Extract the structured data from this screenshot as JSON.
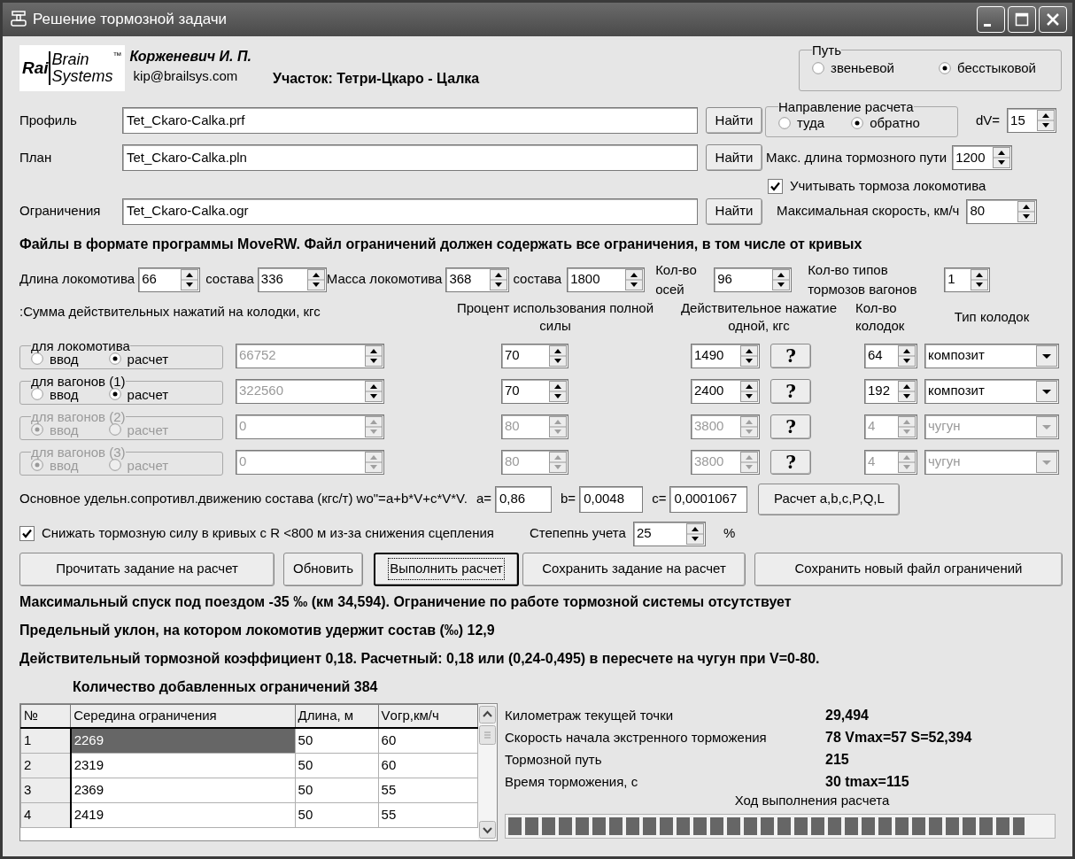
{
  "window": {
    "title": "Решение тормозной задачи"
  },
  "logo": {
    "word_1": "Rai",
    "word_2": "Brain",
    "word_3": "Systems",
    "trademark": "™"
  },
  "author": {
    "name": "Корженевич И. П.",
    "email": "kip@brailsys.com"
  },
  "section": "Участок: Тетри-Цкаро - Цалка",
  "track_type": {
    "legend": "Путь",
    "options": [
      {
        "label": "звеньевой",
        "selected": false
      },
      {
        "label": "бесстыковой",
        "selected": true
      }
    ]
  },
  "files": [
    {
      "label": "Профиль",
      "value": "Tet_Ckaro-Calka.prf",
      "button": "Найти"
    },
    {
      "label": "План",
      "value": "Tet_Ckaro-Calka.pln",
      "button": "Найти"
    },
    {
      "label": "Ограничения",
      "value": "Tet_Ckaro-Calka.ogr",
      "button": "Найти"
    }
  ],
  "direction": {
    "legend": "Направление расчета",
    "options": [
      {
        "label": "туда",
        "selected": false
      },
      {
        "label": "обратно",
        "selected": true
      }
    ]
  },
  "dv": {
    "label": "dV=",
    "value": "15"
  },
  "max_brake_distance": {
    "label": "Макс. длина тормозного пути",
    "value": "1200"
  },
  "loco_brakes": {
    "label": "Учитывать тормоза локомотива",
    "checked": true
  },
  "max_speed": {
    "label": "Максимальная скорость, км/ч",
    "value": "80"
  },
  "files_note": "Файлы в формате программы MoveRW. Файл ограничений должен содержать все ограничения, в том числе от кривых",
  "train_params": [
    {
      "label": "Длина локомотива",
      "value": "66"
    },
    {
      "label": "состава",
      "value": "336"
    },
    {
      "label": "Масса локомотива",
      "value": "368"
    },
    {
      "label": "состава",
      "value": "1800"
    },
    {
      "label": "Кол-во осей",
      "value": "96"
    },
    {
      "label": "Кол-во типов тормозов вагонов",
      "value": "1"
    }
  ],
  "brake_headers": [
    ":Сумма действительных нажатий на колодки, кгс",
    "Процент использования полной силы",
    "Действительное нажатие одной, кгс",
    "Кол-во колодок",
    "Тип колодок"
  ],
  "brake_rows": [
    {
      "legend": "для локомотива",
      "disabled": false,
      "options": [
        {
          "label": "ввод",
          "selected": false
        },
        {
          "label": "расчет",
          "selected": true
        }
      ],
      "total": "66752",
      "percent": "70",
      "actual": "1490",
      "help": "?",
      "count": "64",
      "shoe_type": "композит"
    },
    {
      "legend": "для вагонов (1)",
      "disabled": false,
      "options": [
        {
          "label": "ввод",
          "selected": false
        },
        {
          "label": "расчет",
          "selected": true
        }
      ],
      "total": "322560",
      "percent": "70",
      "actual": "2400",
      "help": "?",
      "count": "192",
      "shoe_type": "композит"
    },
    {
      "legend": "для вагонов (2)",
      "disabled": true,
      "options": [
        {
          "label": "ввод",
          "selected": true
        },
        {
          "label": "расчет",
          "selected": false
        }
      ],
      "total": "0",
      "percent": "80",
      "actual": "3800",
      "help": "?",
      "count": "4",
      "shoe_type": "чугун"
    },
    {
      "legend": "для вагонов (3)",
      "disabled": true,
      "options": [
        {
          "label": "ввод",
          "selected": true
        },
        {
          "label": "расчет",
          "selected": false
        }
      ],
      "total": "0",
      "percent": "80",
      "actual": "3800",
      "help": "?",
      "count": "4",
      "shoe_type": "чугун"
    }
  ],
  "resistance": {
    "label": "Основное удельн.сопротивл.движению состава (кгс/т) wo\"=a+b*V+c*V*V.",
    "coefficients": [
      {
        "label": "a=",
        "value": "0,86"
      },
      {
        "label": "b=",
        "value": "0,0048"
      },
      {
        "label": "c=",
        "value": "0,0001067"
      }
    ],
    "button": "Расчет a,b,c,P,Q,L"
  },
  "curve_reduction": {
    "label": "Снижать тормозную силу в кривых с R <800 м из-за снижения сцепления",
    "checked": true,
    "degree_label": "Степепнь учета",
    "degree_value": "25",
    "unit": "%"
  },
  "actions": [
    {
      "label": "Прочитать задание на расчет",
      "focused": false
    },
    {
      "label": "Обновить",
      "focused": false
    },
    {
      "label": "Выполнить расчет",
      "focused": true
    },
    {
      "label": "Сохранить задание на расчет",
      "focused": false
    },
    {
      "label": "Сохранить новый файл ограничений",
      "focused": false
    }
  ],
  "results": [
    "Максимальный спуск под поездом -35 ‰ (км 34,594). Ограничение по работе тормозной системы отсутствует",
    "Предельный уклон, на котором локомотив удержит состав (‰) 12,9",
    "Действительный тормозной коэффициент 0,18. Расчетный: 0,18 или (0,24-0,495) в пересчете на чугун при V=0-80."
  ],
  "added_count": "Количество добавленных ограничений 384",
  "table": {
    "columns": [
      "№",
      "Середина ограничения",
      "Длина, м",
      "Vогр,км/ч"
    ],
    "rows": [
      {
        "cells": [
          "1",
          "2269",
          "50",
          "60"
        ],
        "selected": true
      },
      {
        "cells": [
          "2",
          "2319",
          "50",
          "60"
        ],
        "selected": false
      },
      {
        "cells": [
          "3",
          "2369",
          "50",
          "55"
        ],
        "selected": false
      },
      {
        "cells": [
          "4",
          "2419",
          "50",
          "55"
        ],
        "selected": false
      }
    ]
  },
  "info": [
    {
      "label": "Километраж текущей точки",
      "value": "29,494"
    },
    {
      "label": "Скорость начала экстренного торможения",
      "value": "78  Vmax=57 S=52,394"
    },
    {
      "label": "Тормозной путь",
      "value": "215"
    },
    {
      "label": "Время торможения, с",
      "value": "30  tmax=115"
    }
  ],
  "progress": {
    "label": "Ход выполнения расчета",
    "level": 0.95
  }
}
